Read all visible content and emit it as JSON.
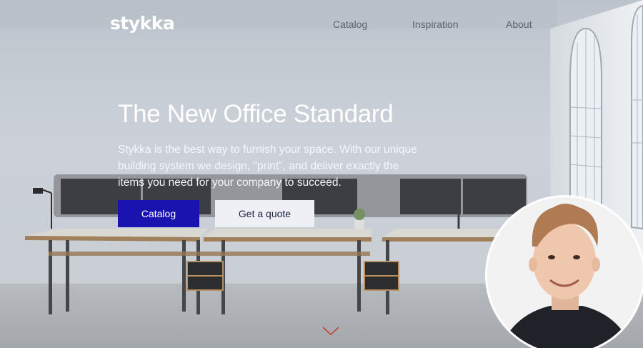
{
  "nav": {
    "logo": "stykka",
    "links": [
      "Catalog",
      "Inspiration",
      "About"
    ]
  },
  "hero": {
    "title": "The New Office Standard",
    "description": "Stykka is the best way to furnish your space. With our unique building system we design, \"print\", and deliver exactly the items you need for your company to succeed.",
    "primary_button": "Catalog",
    "secondary_button": "Get a quote"
  },
  "icons": {
    "scroll": "chevron-down-icon"
  },
  "colors": {
    "accent": "#1a13b0",
    "secondary_button_bg": "#eef0f5",
    "scroll_chevron": "#c0392b"
  }
}
